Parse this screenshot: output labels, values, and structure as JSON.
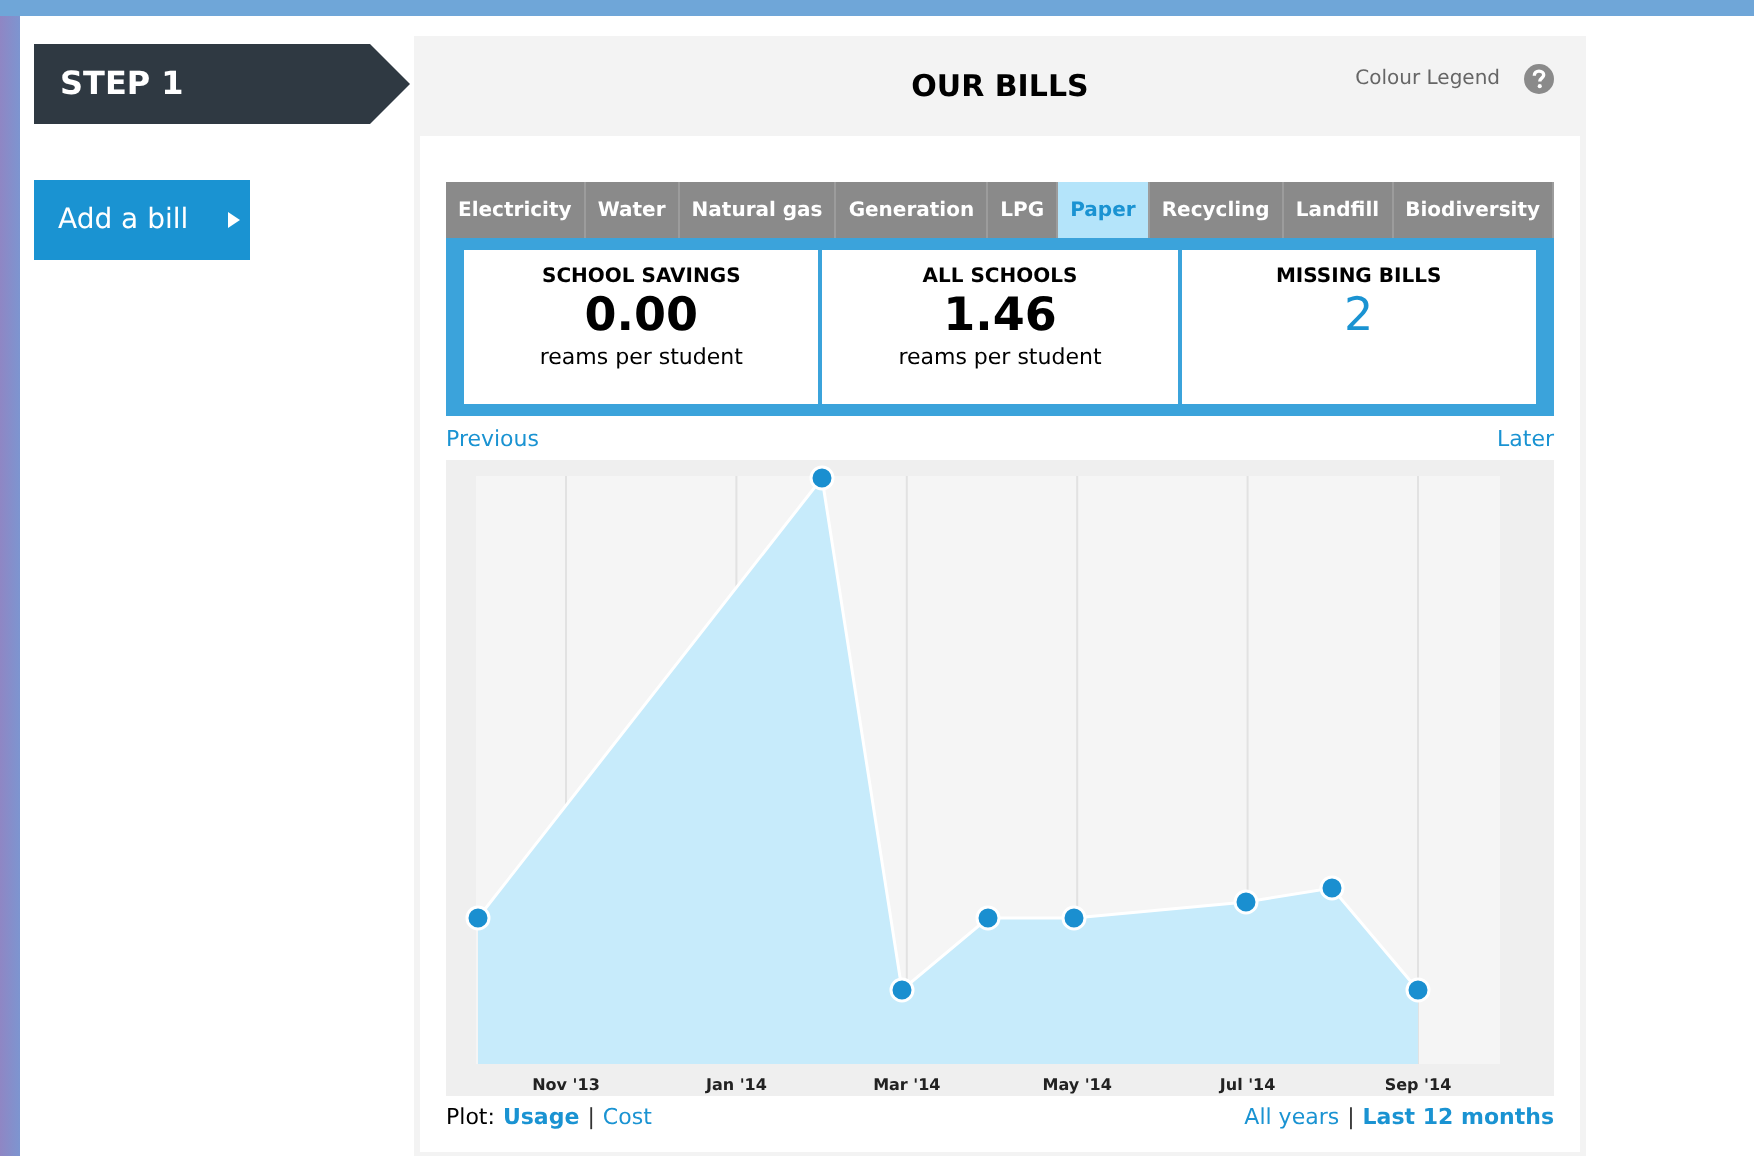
{
  "step": {
    "label": "STEP 1"
  },
  "add_bill_button": {
    "label": "Add a bill"
  },
  "panel": {
    "title": "OUR BILLS",
    "legend_link": "Colour Legend"
  },
  "tabs": [
    {
      "label": "Electricity",
      "selected": false
    },
    {
      "label": "Water",
      "selected": false
    },
    {
      "label": "Natural gas",
      "selected": false
    },
    {
      "label": "Generation",
      "selected": false
    },
    {
      "label": "LPG",
      "selected": false
    },
    {
      "label": "Paper",
      "selected": true
    },
    {
      "label": "Recycling",
      "selected": false
    },
    {
      "label": "Landfill",
      "selected": false
    },
    {
      "label": "Biodiversity",
      "selected": false
    }
  ],
  "stats": [
    {
      "kind": "value",
      "title": "SCHOOL SAVINGS",
      "value": "0.00",
      "unit": "reams per student"
    },
    {
      "kind": "value",
      "title": "ALL SCHOOLS",
      "value": "1.46",
      "unit": "reams per student"
    },
    {
      "kind": "count",
      "title": "MISSING BILLS",
      "value": "2"
    }
  ],
  "nav": {
    "previous": "Previous",
    "later": "Later"
  },
  "chart": {
    "x_labels": [
      "Nov '13",
      "Jan '14",
      "Mar '14",
      "May '14",
      "Jul '14",
      "Sep '14"
    ]
  },
  "plot": {
    "label": "Plot:",
    "separator": "|",
    "options": [
      {
        "label": "Usage",
        "selected": true
      },
      {
        "label": "Cost",
        "selected": false
      }
    ]
  },
  "range": {
    "separator": "|",
    "options": [
      {
        "label": "All years",
        "selected": false
      },
      {
        "label": "Last 12 months",
        "selected": true
      }
    ]
  }
}
